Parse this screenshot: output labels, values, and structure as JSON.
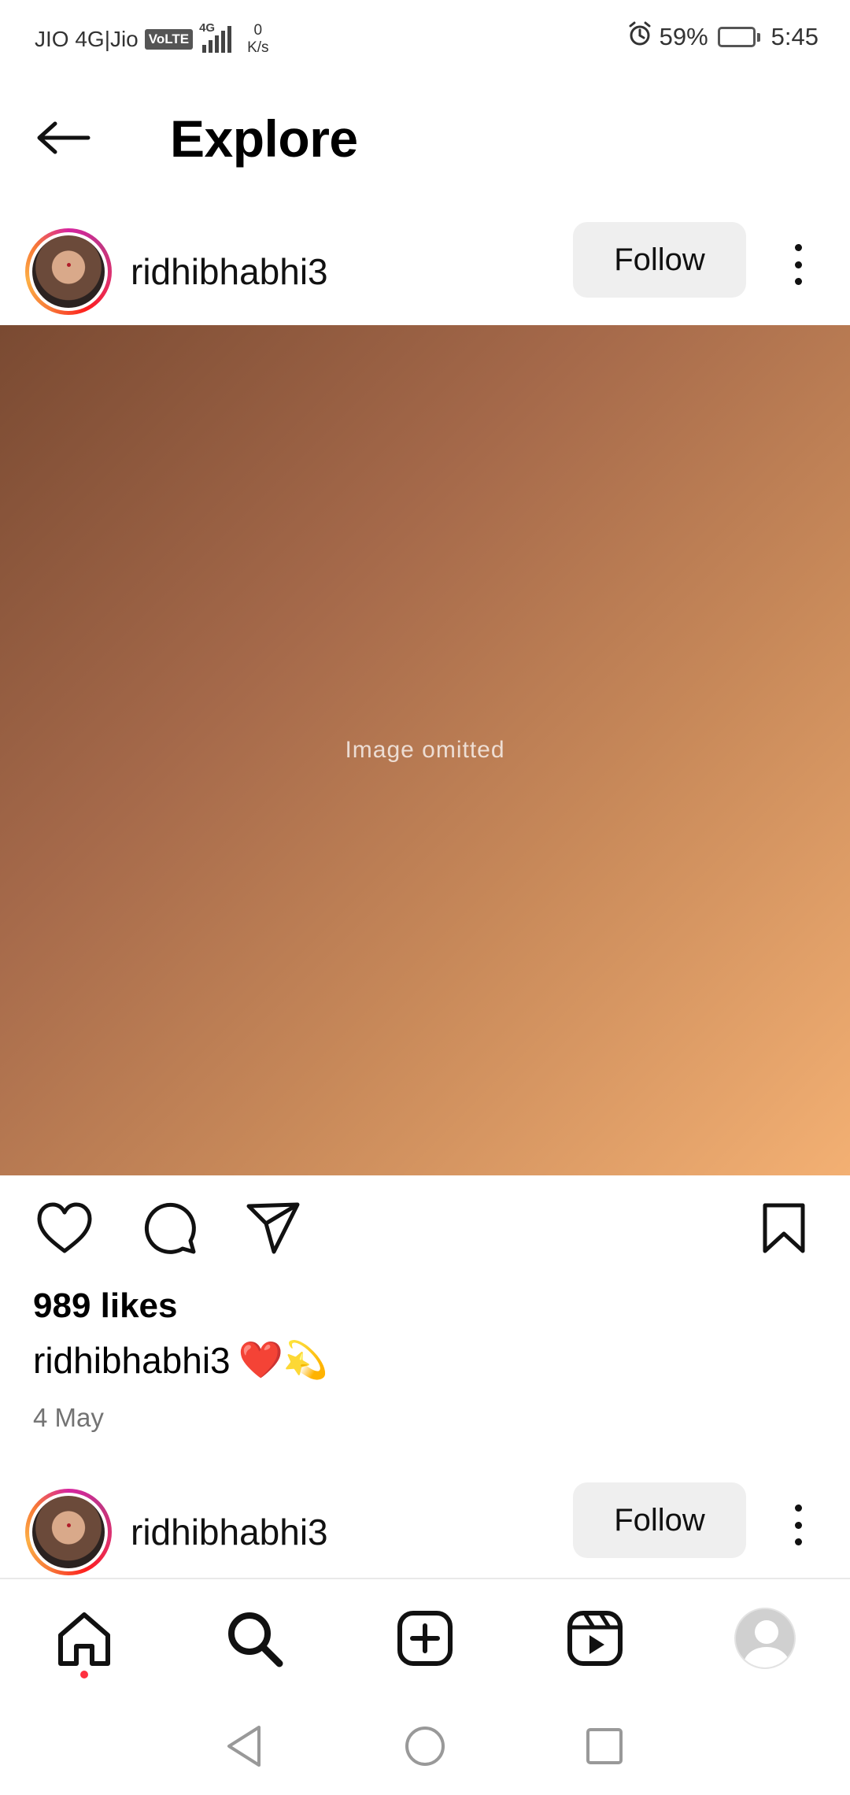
{
  "status_bar": {
    "carrier": "JIO 4G|Jio",
    "volte": "VoLTE",
    "network": "4G",
    "speed_value": "0",
    "speed_unit": "K/s",
    "battery": "59%",
    "battery_level": 0.59,
    "time": "5:45"
  },
  "header": {
    "title": "Explore"
  },
  "posts": [
    {
      "username": "ridhibhabhi3",
      "follow_label": "Follow"
    },
    {
      "username": "ridhibhabhi3",
      "follow_label": "Follow"
    }
  ],
  "post_image": {
    "note": "Image omitted"
  },
  "post_meta": {
    "likes": "989 likes",
    "caption_user": "ridhibhabhi3",
    "caption_emoji": "❤️💫",
    "date": "4 May"
  },
  "nav": [
    "home-icon",
    "search-icon",
    "add-post-icon",
    "reels-icon",
    "profile-avatar"
  ],
  "colors": {
    "notification_dot": "#ff3040",
    "follow_bg": "#efefef",
    "date_grey": "#737373"
  }
}
